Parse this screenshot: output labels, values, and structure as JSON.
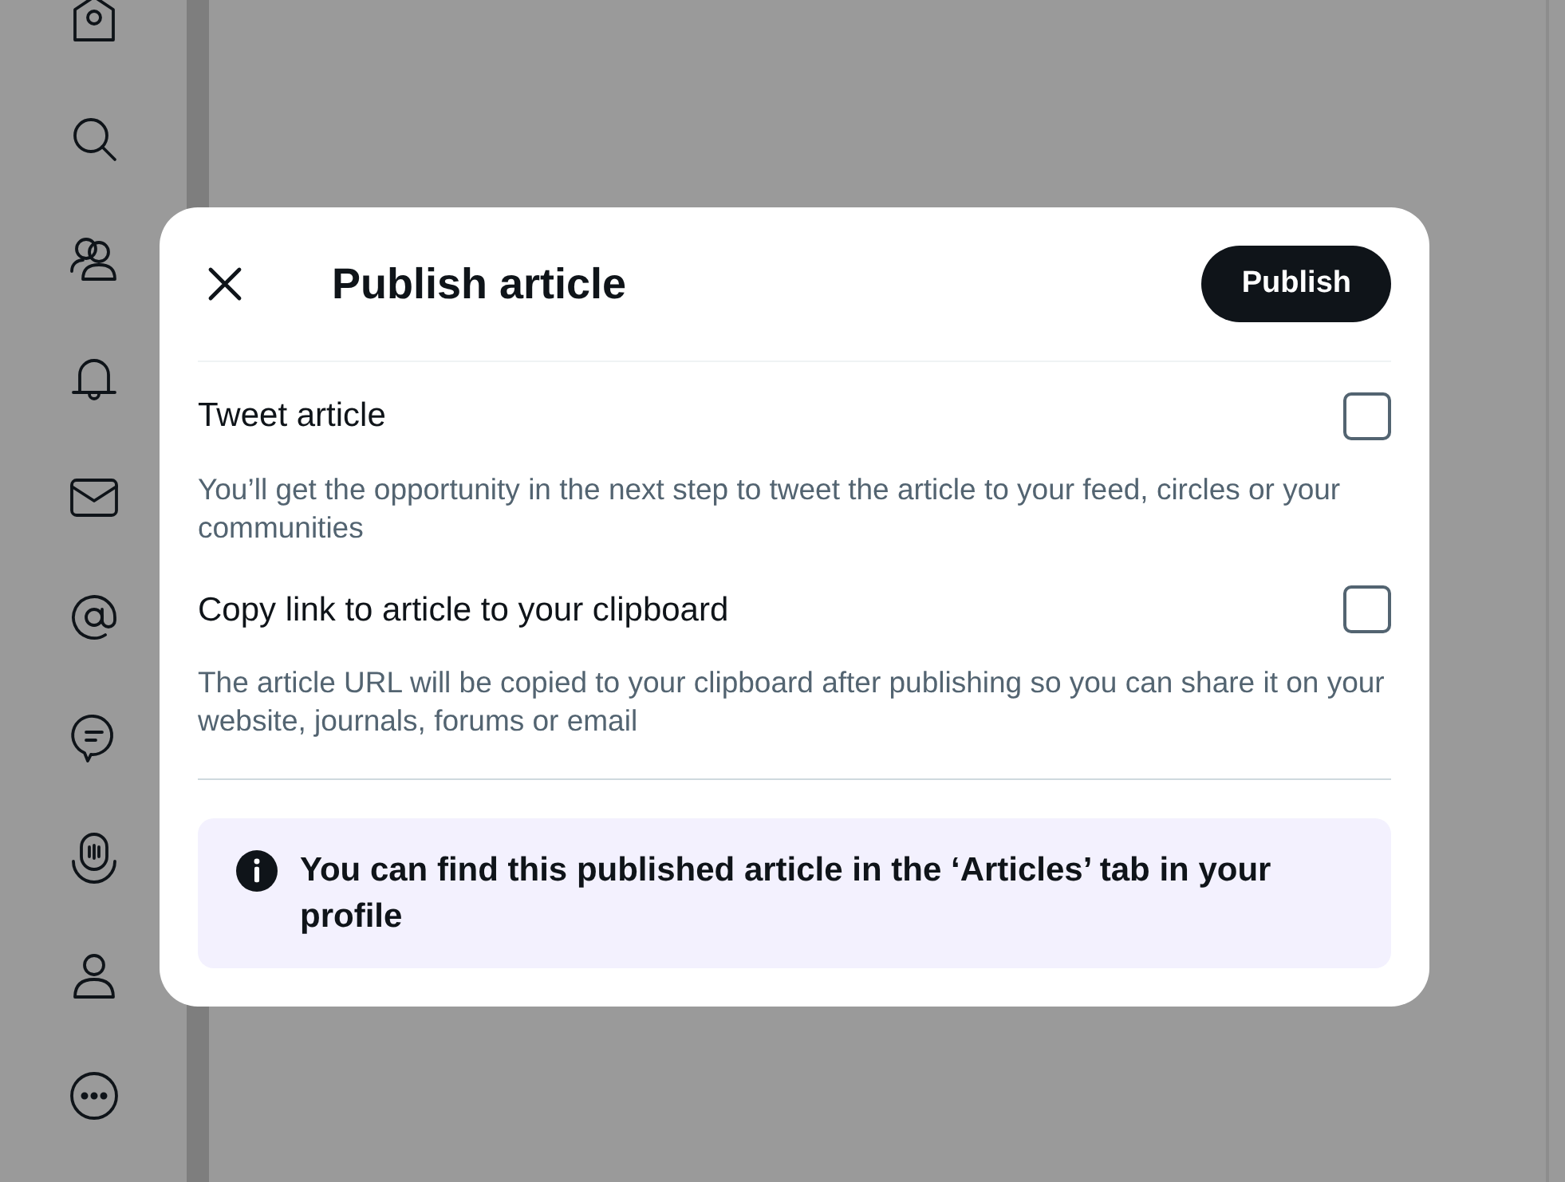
{
  "dialog": {
    "title": "Publish article",
    "publish_button": "Publish",
    "options": [
      {
        "label": "Tweet article",
        "description": "You’ll get the opportunity in the next step to tweet the article to your feed, circles or your communities",
        "checked": false
      },
      {
        "label": "Copy link to article to your clipboard",
        "description": "The article URL will be copied to your clipboard after publishing so you can share it on your website, journals, forums or email",
        "checked": false
      }
    ],
    "info": "You can find this published article in the ‘Articles’ tab in your profile"
  }
}
